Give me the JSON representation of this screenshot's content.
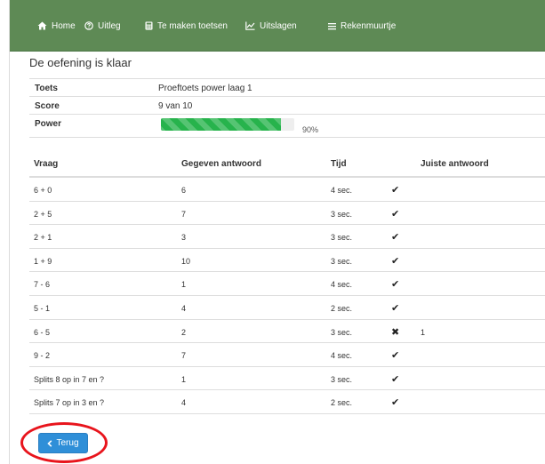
{
  "nav": {
    "items": [
      {
        "label": "Home",
        "icon": "home-icon"
      },
      {
        "label": "Uitleg",
        "icon": "question-circle-icon"
      },
      {
        "label": "Te maken toetsen",
        "icon": "calculator-icon"
      },
      {
        "label": "Uitslagen",
        "icon": "line-chart-icon"
      },
      {
        "label": "Rekenmuurtje",
        "icon": "menu-icon"
      }
    ],
    "background": "#5e8a55"
  },
  "page_title": "De oefening is klaar",
  "summary": {
    "test_label": "Toets",
    "test_value": "Proeftoets power laag 1",
    "score_label": "Score",
    "score_value": "9 van 10",
    "power_label": "Power",
    "power_percent_text": "90%",
    "power_fraction": 0.9,
    "power_color": "#27b34c"
  },
  "results": {
    "headers": {
      "question": "Vraag",
      "given": "Gegeven antwoord",
      "time": "Tijd",
      "correct": "Juiste antwoord"
    },
    "rows": [
      {
        "question": "6 + 0",
        "given": "6",
        "time": "4 sec.",
        "mark": "✔",
        "correct_answer": ""
      },
      {
        "question": "2 + 5",
        "given": "7",
        "time": "3 sec.",
        "mark": "✔",
        "correct_answer": ""
      },
      {
        "question": "2 + 1",
        "given": "3",
        "time": "3 sec.",
        "mark": "✔",
        "correct_answer": ""
      },
      {
        "question": "1 + 9",
        "given": "10",
        "time": "3 sec.",
        "mark": "✔",
        "correct_answer": ""
      },
      {
        "question": "7 - 6",
        "given": "1",
        "time": "4 sec.",
        "mark": "✔",
        "correct_answer": ""
      },
      {
        "question": "5 - 1",
        "given": "4",
        "time": "2 sec.",
        "mark": "✔",
        "correct_answer": ""
      },
      {
        "question": "6 - 5",
        "given": "2",
        "time": "3 sec.",
        "mark": "✖",
        "correct_answer": "1"
      },
      {
        "question": "9 - 2",
        "given": "7",
        "time": "4 sec.",
        "mark": "✔",
        "correct_answer": ""
      },
      {
        "question": "Splits 8 op in 7 en ?",
        "given": "1",
        "time": "3 sec.",
        "mark": "✔",
        "correct_answer": ""
      },
      {
        "question": "Splits 7 op in 3 en ?",
        "given": "4",
        "time": "2 sec.",
        "mark": "✔",
        "correct_answer": ""
      }
    ]
  },
  "back_button": {
    "label": "Terug",
    "icon": "chevron-left-icon",
    "color": "#2f8fd8"
  },
  "annotation_color": "#e8141c"
}
